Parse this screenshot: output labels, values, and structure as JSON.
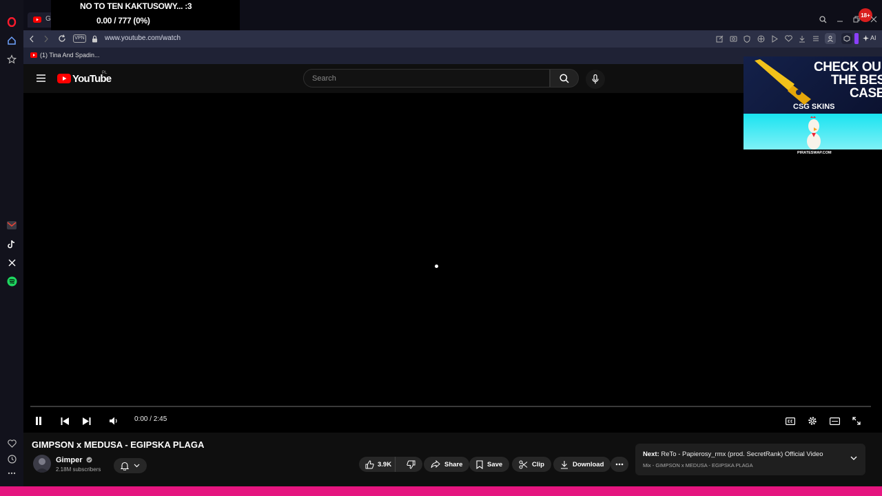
{
  "browser": {
    "tab_title": "Gi",
    "url": "www.youtube.com/watch",
    "vpn_label": "VPN",
    "bookmark_label": "(1) Tina And Spadin...",
    "notification_count": "18+",
    "aria_label": "Aria",
    "ai_label": "AI"
  },
  "stream_overlay": {
    "line1": "NO TO TEN KAKTUSOWY... :3",
    "line2": "0.00 / 777 (0%)"
  },
  "youtube": {
    "logo_text": "YouTube",
    "region": "PL",
    "search_placeholder": "Search"
  },
  "ad": {
    "headline_1": "CHECK OU",
    "headline_2": "THE BES",
    "headline_3": "CASE",
    "brand": "CSG SKINS",
    "footer": "PIRATESWAP.COM"
  },
  "player": {
    "time": "0:00 / 2:45",
    "progress_fraction": 0
  },
  "video": {
    "title": "GIMPSON x MEDUSA - EGIPSKA PLAGA",
    "channel": "Gimper",
    "subscribers": "2.18M subscribers",
    "likes": "3.9K",
    "share_label": "Share",
    "save_label": "Save",
    "clip_label": "Clip",
    "download_label": "Download"
  },
  "next": {
    "prefix": "Next:",
    "title": "ReTo - Papierosy_rmx (prod. SecretRank) Official Video",
    "mix": "Mix - GIMPSON x MEDUSA - EGIPSKA PLAGA"
  },
  "colors": {
    "bottom_strip": "#e5157f",
    "youtube_red": "#ff0000",
    "opera_red": "#ff1b2d"
  }
}
